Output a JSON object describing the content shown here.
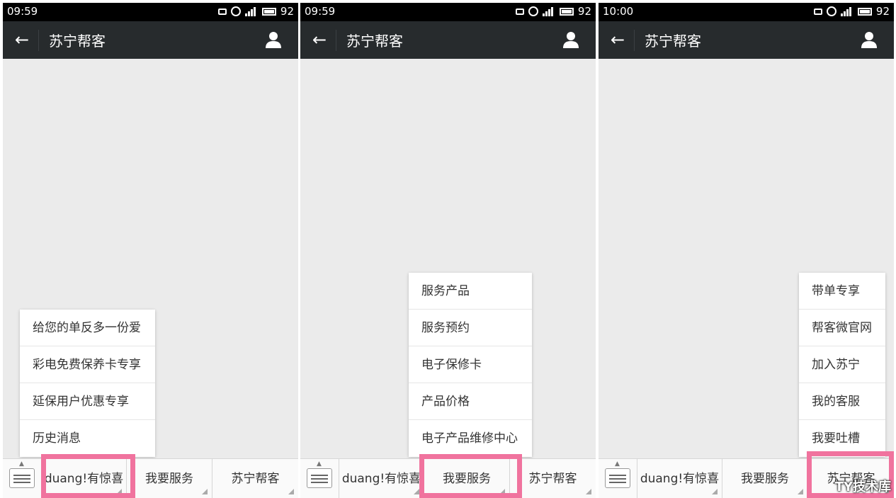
{
  "screens": [
    {
      "time": "09:59",
      "battery": "92",
      "title": "苏宁帮客",
      "menu": [
        "给您的单反多一份爱",
        "彩电免费保养卡专享",
        "延保用户优惠专享",
        "历史消息"
      ],
      "tabs": [
        "duang!有惊喜",
        "我要服务",
        "苏宁帮客"
      ],
      "highlighted_tab": "duang!有惊喜"
    },
    {
      "time": "09:59",
      "battery": "92",
      "title": "苏宁帮客",
      "menu": [
        "服务产品",
        "服务预约",
        "电子保修卡",
        "产品价格",
        "电子产品维修中心"
      ],
      "tabs": [
        "duang!有惊喜",
        "我要服务",
        "苏宁帮客"
      ],
      "highlighted_tab": "我要服务"
    },
    {
      "time": "10:00",
      "battery": "92",
      "title": "苏宁帮客",
      "menu": [
        "带单专享",
        "帮客微官网",
        "加入苏宁",
        "我的客服",
        "我要吐槽"
      ],
      "tabs": [
        "duang!有惊喜",
        "我要服务",
        "苏宁帮客"
      ],
      "highlighted_tab": "苏宁帮客"
    }
  ],
  "icons": {
    "back": "arrow-left-icon",
    "profile": "person-icon",
    "keyboard": "keyboard-icon"
  },
  "colors": {
    "titlebar": "#272b2d",
    "highlight": "#f0739e",
    "chat_bg": "#ebebeb"
  },
  "watermark": "TY技术库"
}
